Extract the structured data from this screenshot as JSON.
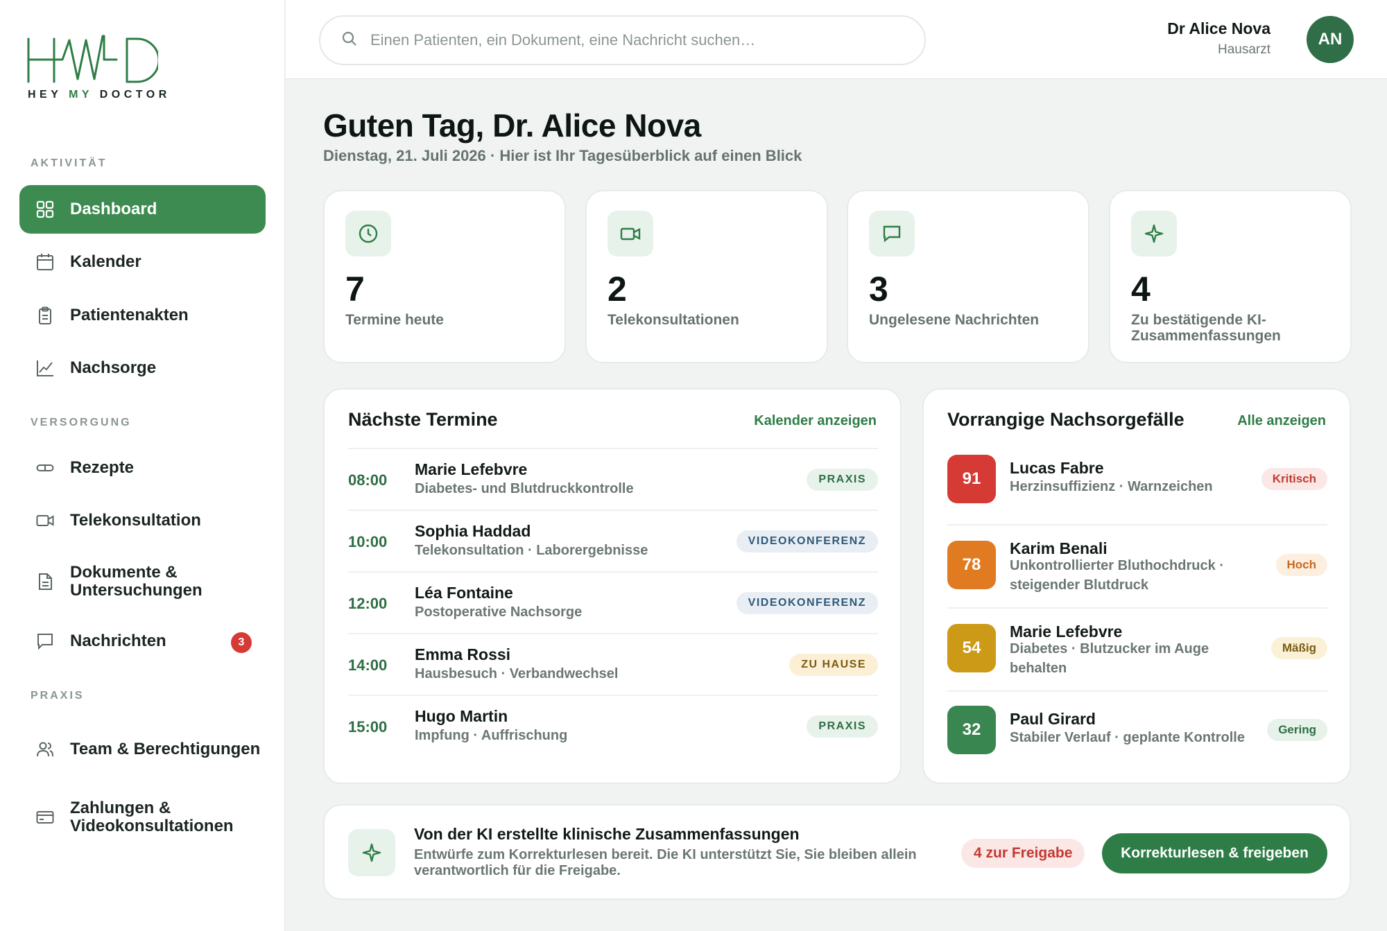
{
  "logo": {
    "text_prefix": "HEY ",
    "text_accent": "MY",
    "text_suffix": " DOCTOR"
  },
  "sidebar": {
    "sections": [
      {
        "label": "AKTIVITÄT"
      },
      {
        "label": "VERSORGUNG"
      },
      {
        "label": "PRAXIS"
      }
    ],
    "items": [
      {
        "label": "Dashboard",
        "icon": "grid-icon",
        "active": true
      },
      {
        "label": "Kalender",
        "icon": "calendar-icon"
      },
      {
        "label": "Patientenakten",
        "icon": "clipboard-icon"
      },
      {
        "label": "Nachsorge",
        "icon": "chart-line-icon"
      },
      {
        "label": "Rezepte",
        "icon": "pill-icon"
      },
      {
        "label": "Telekonsultation",
        "icon": "video-icon"
      },
      {
        "label": "Dokumente & Untersuchungen",
        "icon": "document-icon"
      },
      {
        "label": "Nachrichten",
        "icon": "message-icon",
        "badge": "3"
      },
      {
        "label": "Team & Berechtigungen",
        "icon": "users-icon"
      },
      {
        "label": "Zahlungen & Videokonsultationen",
        "icon": "credit-card-icon"
      }
    ]
  },
  "header": {
    "search_placeholder": "Einen Patienten, ein Dokument, eine Nachricht suchen…",
    "user_name": "Dr Alice Nova",
    "user_role": "Hausarzt",
    "avatar_initials": "AN"
  },
  "greeting": {
    "title": "Guten Tag, Dr. Alice Nova",
    "subtitle": "Dienstag, 21. Juli 2026 · Hier ist Ihr Tagesüberblick auf einen Blick"
  },
  "stats": [
    {
      "value": "7",
      "label": "Termine heute",
      "icon": "clock-icon"
    },
    {
      "value": "2",
      "label": "Telekonsultationen",
      "icon": "video-icon"
    },
    {
      "value": "3",
      "label": "Ungelesene Nachrichten",
      "icon": "message-icon"
    },
    {
      "value": "4",
      "label": "Zu bestätigende KI-Zusammenfassungen",
      "icon": "sparkle-icon"
    }
  ],
  "appointments": {
    "title": "Nächste Termine",
    "link": "Kalender anzeigen",
    "rows": [
      {
        "time": "08:00",
        "name": "Marie Lefebvre",
        "desc": "Diabetes- und Blutdruckkontrolle",
        "tag": "PRAXIS",
        "tag_type": "praxis"
      },
      {
        "time": "10:00",
        "name": "Sophia Haddad",
        "desc": "Telekonsultation · Laborergebnisse",
        "tag": "VIDEOKONFERENZ",
        "tag_type": "video"
      },
      {
        "time": "12:00",
        "name": "Léa Fontaine",
        "desc": "Postoperative Nachsorge",
        "tag": "VIDEOKONFERENZ",
        "tag_type": "video"
      },
      {
        "time": "14:00",
        "name": "Emma Rossi",
        "desc": "Hausbesuch · Verbandwechsel",
        "tag": "ZU HAUSE",
        "tag_type": "home"
      },
      {
        "time": "15:00",
        "name": "Hugo Martin",
        "desc": "Impfung · Auffrischung",
        "tag": "PRAXIS",
        "tag_type": "praxis"
      }
    ]
  },
  "cases": {
    "title": "Vorrangige Nachsorgefälle",
    "link": "Alle anzeigen",
    "rows": [
      {
        "score": "91",
        "name": "Lucas Fabre",
        "desc": "Herzinsuffizienz · Warnzeichen",
        "priority": "Kritisch",
        "score_color": "#d63a34",
        "prio_bg": "#fbe8e6",
        "prio_color": "#c23a31"
      },
      {
        "score": "78",
        "name": "Karim Benali",
        "desc": "Unkontrollierter Bluthochdruck · steigender Blutdruck",
        "priority": "Hoch",
        "score_color": "#e07b22",
        "prio_bg": "#fcefe0",
        "prio_color": "#c9681a"
      },
      {
        "score": "54",
        "name": "Marie Lefebvre",
        "desc": "Diabetes · Blutzucker im Auge behalten",
        "priority": "Mäßig",
        "score_color": "#cc9a16",
        "prio_bg": "#faf1d6",
        "prio_color": "#7a5b12"
      },
      {
        "score": "32",
        "name": "Paul Girard",
        "desc": "Stabiler Verlauf · geplante Kontrolle",
        "priority": "Gering",
        "score_color": "#3a8651",
        "prio_bg": "#e7f2ea",
        "prio_color": "#2e6e44"
      }
    ]
  },
  "ai_summary": {
    "title": "Von der KI erstellte klinische Zusammenfassungen",
    "desc": "Entwürfe zum Korrekturlesen bereit. Die KI unterstützt Sie, Sie bleiben allein verantwortlich für die Freigabe.",
    "pending": "4 zur Freigabe",
    "button": "Korrekturlesen & freigeben"
  },
  "colors": {
    "accent": "#2e7d46",
    "active_nav": "#3d8b50",
    "danger": "#d63a34"
  }
}
